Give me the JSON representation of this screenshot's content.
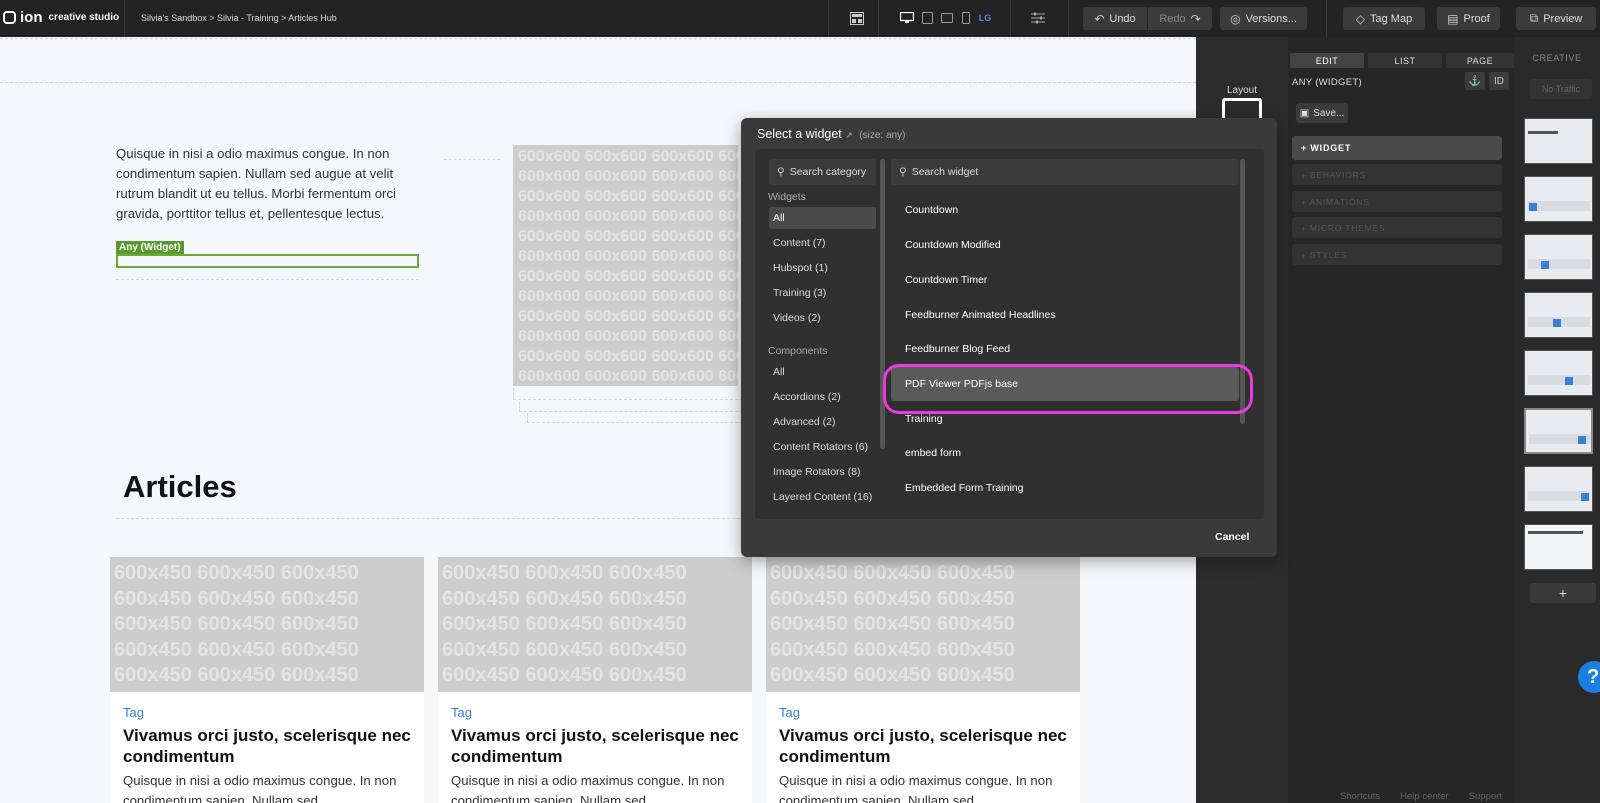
{
  "app": {
    "brand": "ion",
    "product": "creative studio"
  },
  "breadcrumb": "Silvia's Sandbox > Silvia - Training > Articles Hub",
  "toolbar": {
    "device_size": "LG",
    "undo": "Undo",
    "redo": "Redo",
    "versions": "Versions...",
    "tag_map": "Tag Map",
    "proof": "Proof",
    "preview": "Preview"
  },
  "canvas": {
    "paragraph": "Quisque in nisi a odio maximus congue. In non condimentum sapien. Nullam sed augue at velit rutrum blandit ut eu tellus. Morbi fermentum orci gravida, porttitor tellus et, pellentesque lectus.",
    "any_widget_label": "Any (Widget)",
    "placeholder_600": "600x600",
    "articles_heading": "Articles",
    "placeholder_450": "600x450",
    "cards": [
      {
        "tag": "Tag",
        "title": "Vivamus orci justo, scelerisque nec condimentum",
        "text": "Quisque in nisi a odio maximus congue. In non condimentum sapien. Nullam sed"
      },
      {
        "tag": "Tag",
        "title": "Vivamus orci justo, scelerisque nec condimentum",
        "text": "Quisque in nisi a odio maximus congue. In non condimentum sapien. Nullam sed"
      },
      {
        "tag": "Tag",
        "title": "Vivamus orci justo, scelerisque nec condimentum",
        "text": "Quisque in nisi a odio maximus congue. In non condimentum sapien. Nullam sed"
      }
    ]
  },
  "layout_panel": {
    "label": "Layout"
  },
  "edit_panel": {
    "tabs": [
      "EDIT",
      "LIST",
      "PAGE"
    ],
    "header": "ANY (WIDGET)",
    "id_label": "ID",
    "save": "Save...",
    "sections": [
      "+ WIDGET",
      "+ BEHAVIORS",
      "+ ANIMATIONS",
      "+ MICRO THEMES",
      "+ STYLES"
    ]
  },
  "creative_panel": {
    "label": "CREATIVE",
    "no_traffic": "No Traffic",
    "add": "+"
  },
  "modal": {
    "title": "Select a widget",
    "size_note": "(size: any)",
    "search_category_placeholder": "Search category",
    "search_widget_placeholder": "Search widget",
    "widgets_group": "Widgets",
    "widget_categories": [
      "All",
      "Content (7)",
      "Hubspot (1)",
      "Training (3)",
      "Videos (2)"
    ],
    "components_group": "Components",
    "component_categories": [
      "All",
      "Accordions (2)",
      "Advanced (2)",
      "Content Rotators (6)",
      "Image Rotators (8)",
      "Layered Content (16)"
    ],
    "widgets": [
      "Countdown",
      "Countdown Modified",
      "Countdown Timer",
      "Feedburner Animated Headlines",
      "Feedburner Blog Feed",
      "PDF Viewer PDFjs base",
      "Training",
      "embed form",
      "Embedded Form Training"
    ],
    "selected_widget": "PDF Viewer PDFjs base",
    "cancel": "Cancel"
  },
  "footer": {
    "shortcuts": "Shortcuts",
    "help_center": "Help center",
    "support": "Support"
  },
  "help_bubble": "?",
  "colors": {
    "accent": "#3a7fd0",
    "highlight_ring": "#ea3be0",
    "widget_green": "#5a9a2c"
  }
}
